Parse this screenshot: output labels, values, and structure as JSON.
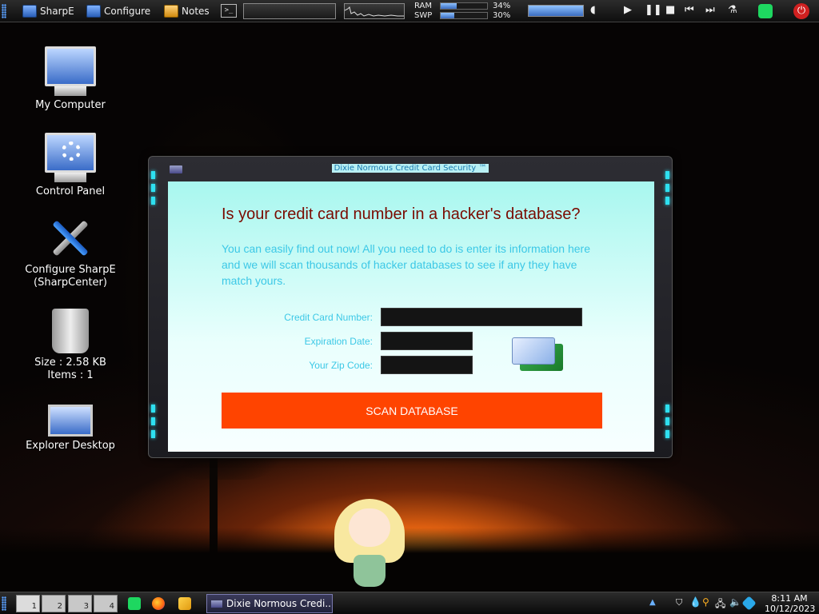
{
  "topbar": {
    "sharpe_label": "SharpE",
    "configure_label": "Configure",
    "notes_label": "Notes",
    "terminal_glyph": ">_",
    "ram_label": "RAM",
    "swp_label": "SWP",
    "ram_pct": "34%",
    "swp_pct": "30%",
    "ram_usage": 0.34,
    "swp_usage": 0.3
  },
  "desktop": {
    "icons": [
      {
        "label": "My Computer",
        "icon": "computer-icon"
      },
      {
        "label": "Control Panel",
        "icon": "control-panel-icon"
      },
      {
        "label": "Configure SharpE\n(SharpCenter)",
        "icon": "tools-icon"
      },
      {
        "label": "Size : 2.58 KB\nItems : 1",
        "icon": "recycle-bin-icon"
      },
      {
        "label": "Explorer Desktop",
        "icon": "explorer-icon"
      }
    ]
  },
  "window": {
    "title": "Dixie Normous Credit Card Security ™",
    "heading": "Is your credit card number in a hacker's database?",
    "intro": "You can easily find out now! All you need to do is enter its information here and we will scan thousands of hacker databases to see if any they have match yours.",
    "card_number_label": "Credit Card Number:",
    "expiration_label": "Expiration Date:",
    "zip_label": "Your Zip Code:",
    "card_number_value": "",
    "expiration_value": "",
    "zip_value": "",
    "scan_button": "SCAN DATABASE",
    "accent_color": "#ff4400",
    "heading_color": "#7a0a00",
    "text_color": "#3cc8e6"
  },
  "taskbar": {
    "workspaces": [
      "1",
      "2",
      "3",
      "4"
    ],
    "task_label": "Dixie Normous Credi...",
    "time": "8:11 AM",
    "date": "10/12/2023"
  }
}
